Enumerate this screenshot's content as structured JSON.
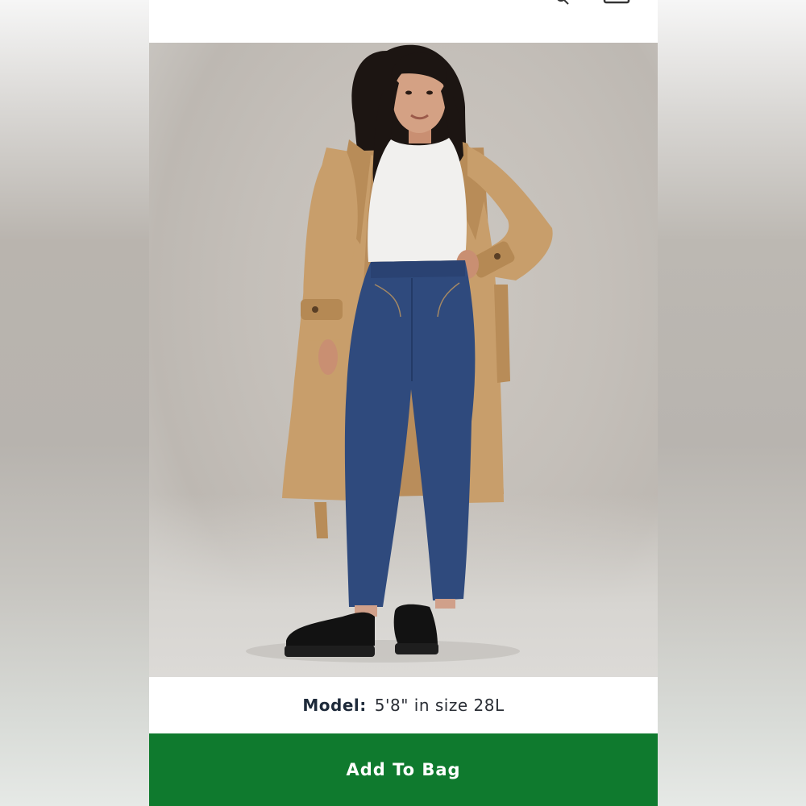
{
  "product": {
    "model_label": "Model:",
    "model_value": "5'8\" in size 28L",
    "add_to_bag_label": "Add To Bag"
  },
  "icons": {
    "search": "search-icon",
    "bag": "bag-icon"
  },
  "colors": {
    "accent": "#0f7a2e",
    "text": "#1e2a3a",
    "background": "#ffffff"
  }
}
